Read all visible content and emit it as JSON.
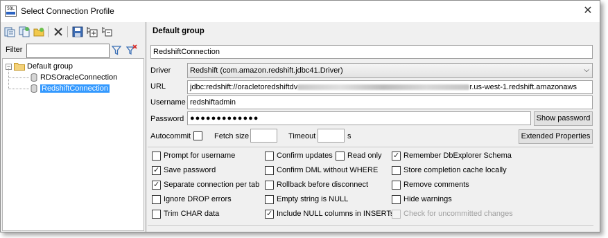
{
  "window": {
    "title": "Select Connection Profile",
    "app_icon_text": "SQL"
  },
  "left_panel": {
    "toolbar_icons": [
      "new-profile-icon",
      "copy-profile-icon",
      "new-group-icon",
      "delete-icon",
      "save-icon",
      "add-folder-icon",
      "move-icon"
    ],
    "filter_label": "Filter",
    "filter_value": "",
    "tree": {
      "group": "Default group",
      "items": [
        "RDSOracleConnection",
        "RedshiftConnection"
      ],
      "selected": "RedshiftConnection"
    }
  },
  "right_panel": {
    "group_title": "Default group",
    "profile_name": "RedshiftConnection",
    "driver_label": "Driver",
    "driver_value": "Redshift (com.amazon.redshift.jdbc41.Driver)",
    "url_label": "URL",
    "url_prefix": "jdbc:redshift://oracletoredshiftdv",
    "url_suffix": "r.us-west-1.redshift.amazonaws",
    "username_label": "Username",
    "username_value": "redshiftadmin",
    "password_label": "Password",
    "password_value": "●●●●●●●●●●●●●",
    "show_password_label": "Show password",
    "autocommit_label": "Autocommit",
    "autocommit_checked": false,
    "fetch_size_label": "Fetch size",
    "fetch_size_value": "",
    "timeout_label": "Timeout",
    "timeout_value": "",
    "timeout_unit": "s",
    "extended_properties_label": "Extended Properties",
    "options": [
      {
        "label": "Prompt for username",
        "checked": false
      },
      {
        "label": "Save password",
        "checked": true
      },
      {
        "label": "Separate connection per tab",
        "checked": true
      },
      {
        "label": "Ignore DROP errors",
        "checked": false
      },
      {
        "label": "Trim CHAR data",
        "checked": false
      },
      {
        "label": "Confirm updates",
        "checked": false
      },
      {
        "label": "Read only",
        "checked": false
      },
      {
        "label": "Confirm DML without WHERE",
        "checked": false
      },
      {
        "label": "Rollback before disconnect",
        "checked": false
      },
      {
        "label": "Empty string is NULL",
        "checked": false
      },
      {
        "label": "Include NULL columns in INSERTs",
        "checked": true
      },
      {
        "label": "Remember DbExplorer Schema",
        "checked": true
      },
      {
        "label": "Store completion cache locally",
        "checked": false
      },
      {
        "label": "Remove comments",
        "checked": false
      },
      {
        "label": "Hide warnings",
        "checked": false
      },
      {
        "label": "Check for uncommitted changes",
        "checked": false,
        "disabled": true
      }
    ]
  },
  "colors": {
    "selection": "#3399ff",
    "window_bg": "#f0f0f0"
  }
}
